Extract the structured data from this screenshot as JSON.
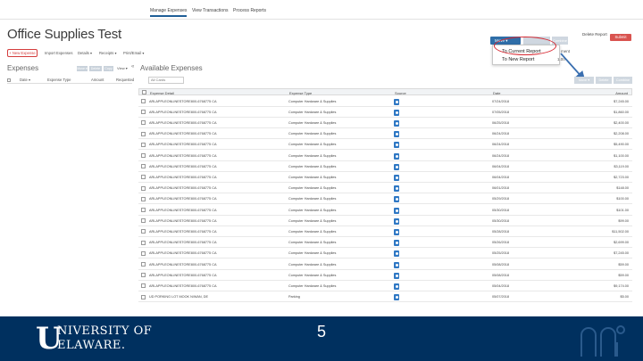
{
  "topnav": {
    "tabs": [
      "Manage Expenses",
      "View Transactions",
      "Process Reports"
    ],
    "active_index": 0
  },
  "report": {
    "title": "Office Supplies Test",
    "delete_label": "Delete Report",
    "submit_label": "Submit Report"
  },
  "toolbar": {
    "new_expense": "+ New Expense",
    "import_expenses": "Import Expenses",
    "details": "Details ▾",
    "receipts": "Receipts ▾",
    "print_email": "Print/Email ▾"
  },
  "move_menu": {
    "button_label": "Move ▾",
    "options": [
      "To Current Report",
      "To New Report"
    ],
    "grey_buttons": [
      "",
      "Combine"
    ]
  },
  "side_texts": [
    "ment",
    "1.00"
  ],
  "left_panel": {
    "heading": "Expenses",
    "columns": [
      "Date ▾",
      "Expense Type",
      "Amount",
      "Requested"
    ],
    "buttons": [
      "Move ▾",
      "Delete",
      "Copy",
      "View ▾"
    ],
    "collapse": "«"
  },
  "available": {
    "title": "Available Expenses",
    "filter_value": "All Cards",
    "buttons": [
      "Move ▾",
      "Delete",
      "Combine"
    ],
    "columns": [
      "Expense Detail",
      "Expense Type",
      "Source",
      "Date",
      "Amount"
    ],
    "rows": [
      {
        "detail": "ARLAPPLEONLINESTORE800-6768775 CA",
        "type": "Computer Hardware & Supplies",
        "date": "07/24/2018",
        "amount": "$7,245.00"
      },
      {
        "detail": "ARLAPPLEONLINESTORE800-6768775 CA",
        "type": "Computer Hardware & Supplies",
        "date": "07/05/2018",
        "amount": "$1,860.00"
      },
      {
        "detail": "ARLAPPLEONLINESTORE800-6768775 CA",
        "type": "Computer Hardware & Supplies",
        "date": "06/25/2018",
        "amount": "$2,400.00"
      },
      {
        "detail": "ARLAPPLEONLINESTORE800-6768775 CA",
        "type": "Computer Hardware & Supplies",
        "date": "06/24/2018",
        "amount": "$2,208.00"
      },
      {
        "detail": "ARLAPPLEONLINESTORE800-6768775 CA",
        "type": "Computer Hardware & Supplies",
        "date": "06/24/2018",
        "amount": "$5,490.00"
      },
      {
        "detail": "ARLAPPLEONLINESTORE800-6768775 CA",
        "type": "Computer Hardware & Supplies",
        "date": "06/24/2018",
        "amount": "$1,100.00"
      },
      {
        "detail": "ARLAPPLEONLINESTORE800-6768775 CA",
        "type": "Computer Hardware & Supplies",
        "date": "06/04/2018",
        "amount": "$3,119.00"
      },
      {
        "detail": "ARLAPPLEONLINESTORE800-6768775 CA",
        "type": "Computer Hardware & Supplies",
        "date": "06/04/2018",
        "amount": "$2,723.00"
      },
      {
        "detail": "ARLAPPLEONLINESTORE800-6768775 CA",
        "type": "Computer Hardware & Supplies",
        "date": "06/01/2018",
        "amount": "$148.00"
      },
      {
        "detail": "ARLAPPLEONLINESTORE800-6768775 CA",
        "type": "Computer Hardware & Supplies",
        "date": "05/29/2018",
        "amount": "$100.00"
      },
      {
        "detail": "ARLAPPLEONLINESTORE800-6768775 CA",
        "type": "Computer Hardware & Supplies",
        "date": "05/30/2018",
        "amount": "$101.00"
      },
      {
        "detail": "ARLAPPLEONLINESTORE800-6768775 CA",
        "type": "Computer Hardware & Supplies",
        "date": "05/30/2018",
        "amount": "$99.00"
      },
      {
        "detail": "ARLAPPLEONLINESTORE800-6768775 CA",
        "type": "Computer Hardware & Supplies",
        "date": "05/28/2018",
        "amount": "$11,502.00"
      },
      {
        "detail": "ARLAPPLEONLINESTORE800-6768775 CA",
        "type": "Computer Hardware & Supplies",
        "date": "05/26/2018",
        "amount": "$2,699.00"
      },
      {
        "detail": "ARLAPPLEONLINESTORE800-6768775 CA",
        "type": "Computer Hardware & Supplies",
        "date": "05/25/2018",
        "amount": "$7,245.00"
      },
      {
        "detail": "ARLAPPLEONLINESTORE800-6768775 CA",
        "type": "Computer Hardware & Supplies",
        "date": "05/08/2018",
        "amount": "$59.00"
      },
      {
        "detail": "ARLAPPLEONLINESTORE800-6768775 CA",
        "type": "Computer Hardware & Supplies",
        "date": "05/08/2018",
        "amount": "$59.00"
      },
      {
        "detail": "ARLAPPLEONLINESTORE800-6768775 CA",
        "type": "Computer Hardware & Supplies",
        "date": "05/04/2018",
        "amount": "$9,174.00"
      },
      {
        "detail": "UD PORKING LOT MOOK N/WAN, DE",
        "type": "Parking",
        "date": "05/07/2018",
        "amount": "$5.00"
      }
    ]
  },
  "footer": {
    "logo_line1": "NIVERSITY OF",
    "logo_line2": "ELAWARE.",
    "logo_initial": "U",
    "page_number": "5"
  }
}
